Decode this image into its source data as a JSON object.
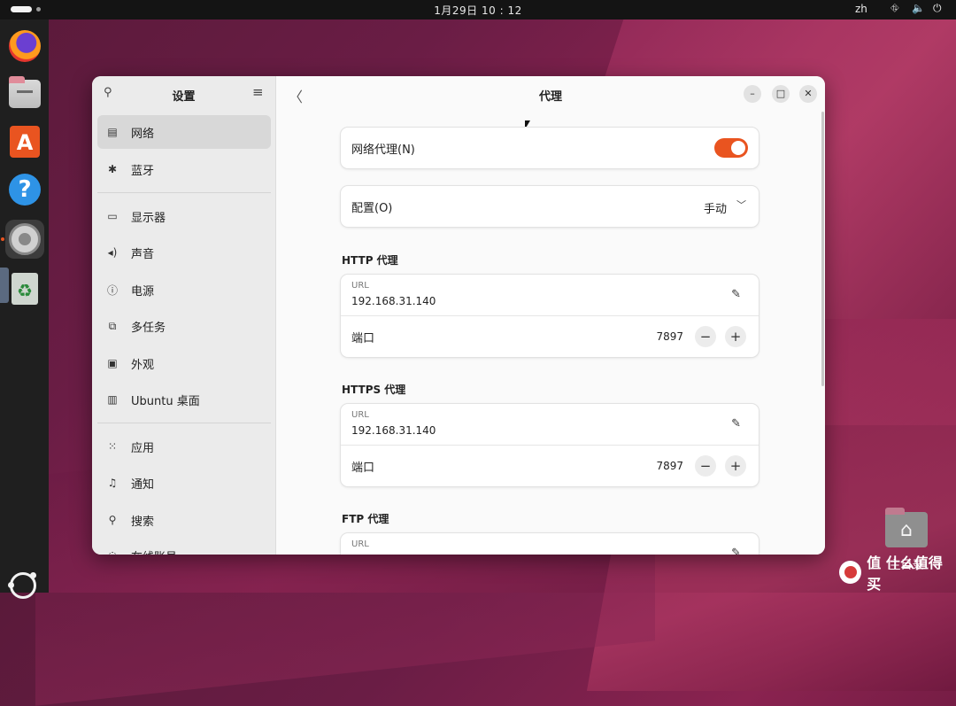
{
  "topbar": {
    "clock": "1月29日  10 : 12",
    "lang": "zh"
  },
  "dock": {
    "items": [
      "firefox-icon",
      "files-icon",
      "app-center-icon",
      "help-icon",
      "settings-icon",
      "trash-icon"
    ]
  },
  "desktop": {
    "home_label": "主目录",
    "watermark": "值 什么值得买"
  },
  "window": {
    "sidebar": {
      "title": "设置",
      "items": [
        {
          "label": "网络",
          "icon": "network-icon"
        },
        {
          "label": "蓝牙",
          "icon": "bluetooth-icon"
        },
        {
          "label": "显示器",
          "icon": "display-icon"
        },
        {
          "label": "声音",
          "icon": "sound-icon"
        },
        {
          "label": "电源",
          "icon": "power-icon"
        },
        {
          "label": "多任务",
          "icon": "multitasking-icon"
        },
        {
          "label": "外观",
          "icon": "appearance-icon"
        },
        {
          "label": "Ubuntu 桌面",
          "icon": "ubuntu-desktop-icon"
        },
        {
          "label": "应用",
          "icon": "apps-icon"
        },
        {
          "label": "通知",
          "icon": "notification-icon"
        },
        {
          "label": "搜索",
          "icon": "search-icon"
        },
        {
          "label": "在线账号",
          "icon": "online-accounts-icon"
        }
      ]
    },
    "main": {
      "title": "代理",
      "network_proxy": {
        "label": "网络代理(N)",
        "enabled": true,
        "accent": "#e95420"
      },
      "config": {
        "label": "配置(O)",
        "value": "手动"
      },
      "http": {
        "heading": "HTTP 代理",
        "url_label": "URL",
        "url": "192.168.31.140",
        "port_label": "端口",
        "port": "7897"
      },
      "https": {
        "heading": "HTTPS 代理",
        "url_label": "URL",
        "url": "192.168.31.140",
        "port_label": "端口",
        "port": "7897"
      },
      "ftp": {
        "heading": "FTP 代理",
        "url_label": "URL"
      }
    }
  }
}
